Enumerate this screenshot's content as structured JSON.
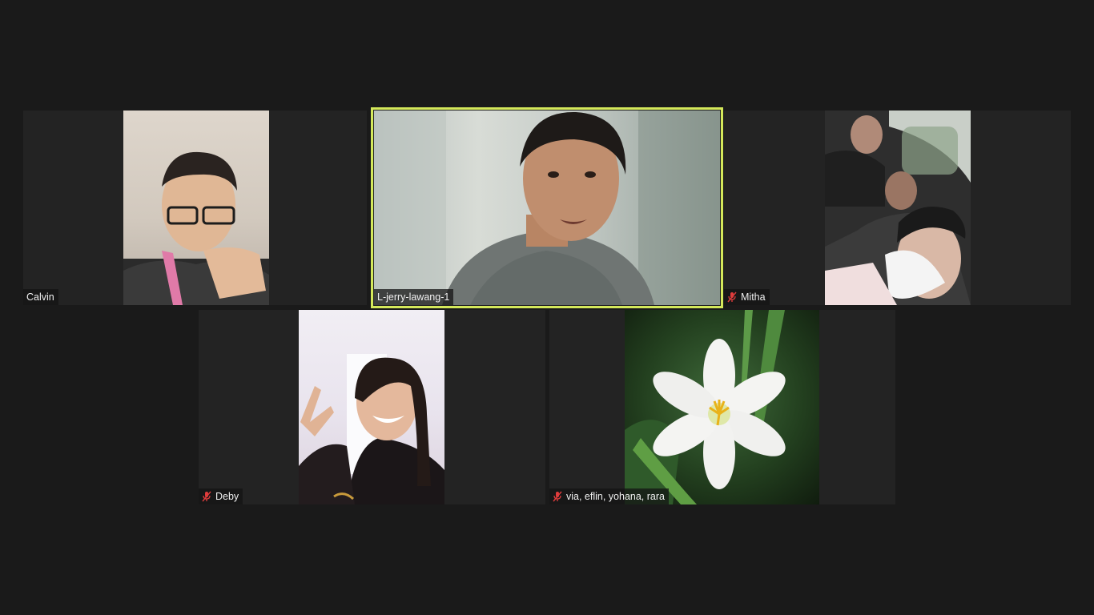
{
  "participants": [
    {
      "id": "calvin",
      "name": "Calvin",
      "muted": false,
      "active": false
    },
    {
      "id": "jerry",
      "name": "L-jerry-lawang-1",
      "muted": false,
      "active": true
    },
    {
      "id": "mitha",
      "name": "Mitha",
      "muted": true,
      "active": false
    },
    {
      "id": "deby",
      "name": "Deby",
      "muted": true,
      "active": false
    },
    {
      "id": "via",
      "name": "via, eflin, yohana, rara",
      "muted": true,
      "active": false
    }
  ],
  "colors": {
    "background": "#1a1a1a",
    "tile": "#232323",
    "active_speaker_border": "#d4e85a",
    "muted_icon": "#e03c3c"
  },
  "icons": {
    "muted": "microphone-muted-icon"
  }
}
